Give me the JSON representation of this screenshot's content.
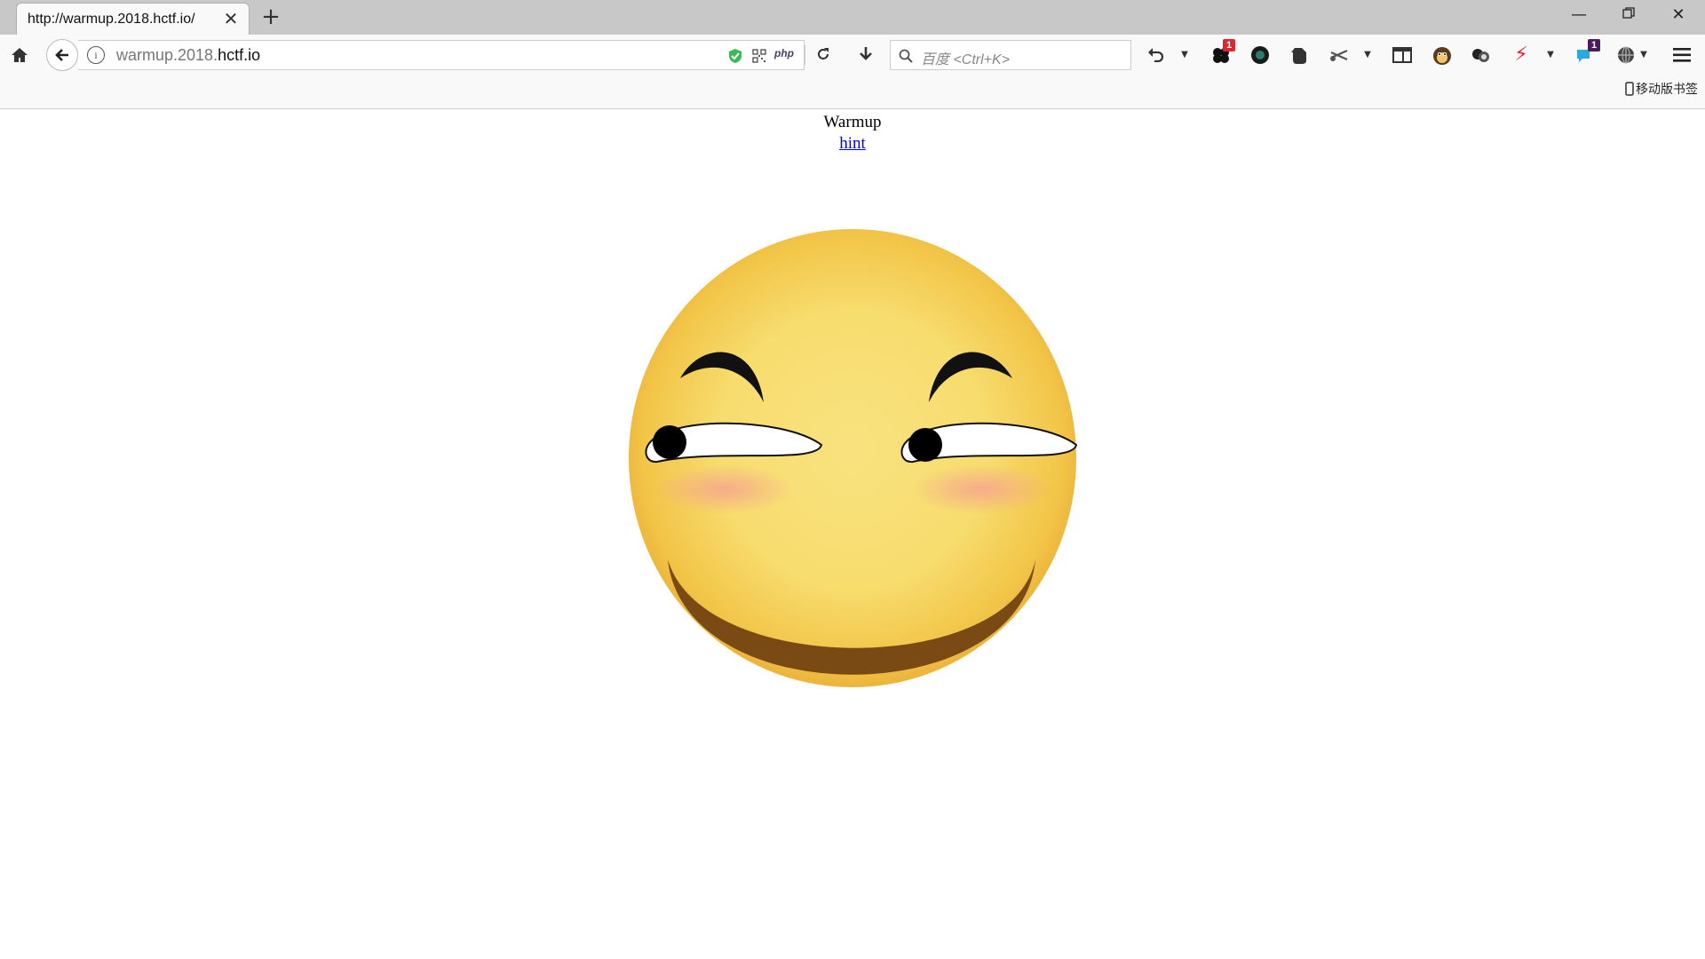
{
  "browser": {
    "tab_title": "http://warmup.2018.hctf.io/",
    "url_host_prefix": "warmup.2018.",
    "url_host_main": "hctf.io",
    "search_placeholder": "百度 <Ctrl+K>",
    "bookmarks_label": "移动版书签",
    "badges": {
      "ext1": "1",
      "ext2": "1"
    },
    "php_label": "php"
  },
  "page": {
    "title": "Warmup",
    "hint_link": "hint",
    "image": "smiley-emoji"
  },
  "colors": {
    "link": "#0000ee",
    "smiley_face": "#f7d35a",
    "badge_red": "#e0262c"
  }
}
